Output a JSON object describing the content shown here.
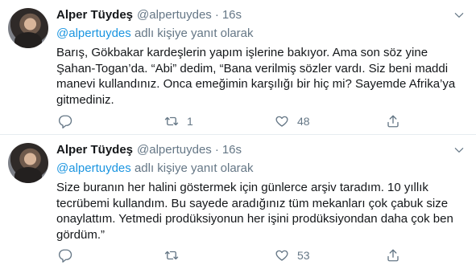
{
  "tweets": [
    {
      "name": "Alper Tüydeş",
      "handle": "@alpertuydes",
      "separator": "·",
      "time": "16s",
      "reply_mention": "@alpertuydes",
      "reply_suffix": "adlı kişiye yanıt olarak",
      "text": "Barış, Gökbakar kardeşlerin yapım işlerine bakıyor. Ama son söz yine Şahan-Togan’da. “Abi” dedim, “Bana verilmiş sözler vardı. Siz beni maddi manevi kullandınız. Onca emeğimin karşılığı bir hiç mi? Sayemde Afrika’ya gitmediniz.",
      "reply_count": "",
      "retweet_count": "1",
      "like_count": "48"
    },
    {
      "name": "Alper Tüydeş",
      "handle": "@alpertuydes",
      "separator": "·",
      "time": "16s",
      "reply_mention": "@alpertuydes",
      "reply_suffix": "adlı kişiye yanıt olarak",
      "text": "Size buranın her halini göstermek için günlerce arşiv taradım. 10 yıllık tecrübemi kullandım. Bu sayede aradığınız tüm mekanları çok çabuk size onaylattım. Yetmedi prodüksiyonun her işini prodüksiyondan daha çok ben gördüm.”",
      "reply_count": "",
      "retweet_count": "",
      "like_count": "53"
    }
  ],
  "icons": {
    "reply": "reply-icon",
    "retweet": "retweet-icon",
    "like": "heart-icon",
    "share": "share-icon",
    "menu": "chevron-down-icon"
  },
  "colors": {
    "link": "#1b95e0",
    "secondary_text": "#657786",
    "primary_text": "#14171a",
    "divider": "#e6ecf0"
  }
}
